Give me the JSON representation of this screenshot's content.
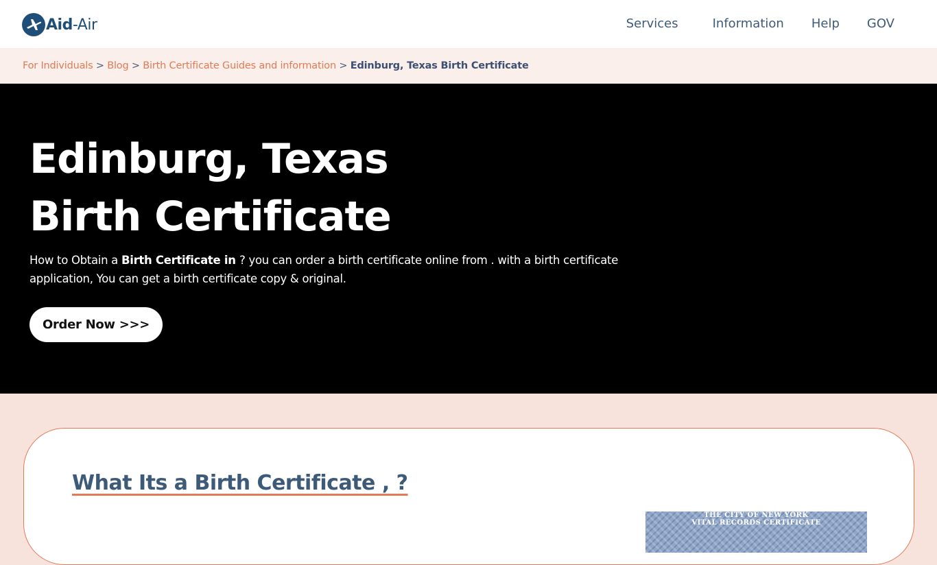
{
  "header": {
    "logo": {
      "aid": "Aid",
      "air": "-Air"
    },
    "nav": [
      "Services",
      "Information",
      "Help",
      "GOV"
    ]
  },
  "breadcrumb": {
    "items": [
      "For Individuals",
      "Blog",
      "Birth Certificate Guides and information"
    ],
    "separator": ">",
    "current": "Edinburg, Texas Birth Certificate"
  },
  "hero": {
    "title": "Edinburg, Texas Birth Certificate",
    "desc_part1": "How to Obtain a ",
    "desc_bold": "Birth Certificate in ",
    "desc_part2": "? you can order a birth certificate online from . with a birth certificate application, You can get a birth certificate copy & original.",
    "button": "Order Now >>>"
  },
  "card": {
    "heading": "What Its a Birth Certificate , ?",
    "image_text_line1": "THE CITY OF NEW YORK",
    "image_text_line2": "VITAL RECORDS CERTIFICATE"
  }
}
